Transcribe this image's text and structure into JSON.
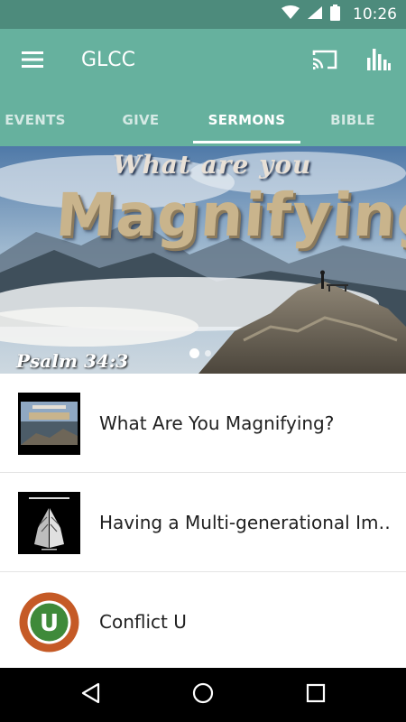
{
  "status_bar": {
    "time": "10:26",
    "icons": [
      "wifi-icon",
      "signal-icon",
      "battery-icon"
    ]
  },
  "app_bar": {
    "title": "GLCC",
    "icons": [
      "menu-icon",
      "cast-icon",
      "bar-chart-icon"
    ]
  },
  "tabs": [
    {
      "label": "EVENTS",
      "active": false
    },
    {
      "label": "GIVE",
      "active": false
    },
    {
      "label": "SERMONS",
      "active": true
    },
    {
      "label": "BIBLE",
      "active": false
    }
  ],
  "hero": {
    "tagline": "What are you",
    "title": "Magnifying?",
    "reference": "Psalm 34:3",
    "pager": {
      "count": 2,
      "active_index": 0
    }
  },
  "sermons": [
    {
      "title": "What Are You Magnifying?",
      "thumbnail": "magnifying-thumbnail"
    },
    {
      "title": "Having a Multi-generational Im…",
      "thumbnail": "praying-hands-thumbnail"
    },
    {
      "title": "Conflict U",
      "thumbnail": "conflict-u-logo-thumbnail"
    }
  ],
  "nav_bar": {
    "icons": [
      "back-icon",
      "home-icon",
      "recents-icon"
    ]
  },
  "colors": {
    "status_bar": "#4d8b7c",
    "app_bar": "#66b19e",
    "nav_bar": "#000000",
    "text_primary": "#212121"
  }
}
